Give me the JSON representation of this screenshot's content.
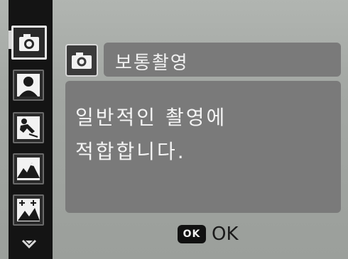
{
  "mode_strip": {
    "items": [
      {
        "icon": "camera-icon",
        "selected": true
      },
      {
        "icon": "portrait-icon",
        "selected": false
      },
      {
        "icon": "sports-icon",
        "selected": false
      },
      {
        "icon": "landscape-icon",
        "selected": false
      },
      {
        "icon": "night-scene-icon",
        "selected": false
      }
    ],
    "scroll_icon": "chevron-down-icon"
  },
  "title": {
    "icon": "camera-icon",
    "label": "보통촬영"
  },
  "description": {
    "line1": "일반적인 촬영에",
    "line2": "적합합니다."
  },
  "ok": {
    "badge": "OK",
    "label": "OK"
  }
}
